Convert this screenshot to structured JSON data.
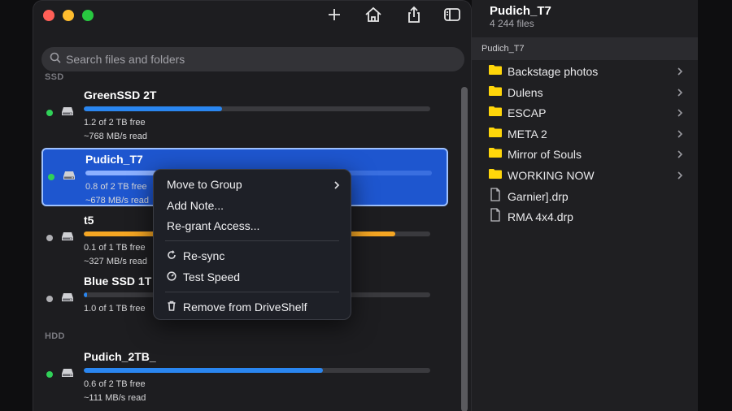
{
  "toolbar": {
    "add_icon": "plus-icon",
    "home_icon": "home-icon",
    "share_icon": "share-icon",
    "sidebar_icon": "sidebar-icon"
  },
  "search": {
    "placeholder": "Search files and folders"
  },
  "sections": {
    "ssd": "SSD",
    "hdd": "HDD"
  },
  "drives": [
    {
      "name": "GreenSSD 2T",
      "free": "1.2 of 2 TB free",
      "speed": "~768 MB/s read",
      "usage": 0.4,
      "bar_color": "#2a86f0",
      "status": "#30d158",
      "selected": false
    },
    {
      "name": "Pudich_T7",
      "free": "0.8 of 2 TB free",
      "speed": "~678 MB/s read",
      "usage": 0.6,
      "bar_color": "#8cb0ff",
      "status": "#30d158",
      "selected": true
    },
    {
      "name": "t5",
      "free": "0.1 of 1 TB free",
      "speed": "~327 MB/s read",
      "usage": 0.9,
      "bar_color": "#f5a623",
      "status": "#b0b0b4",
      "selected": false
    },
    {
      "name": "Blue SSD 1T",
      "free": "1.0 of 1 TB free",
      "speed": "",
      "usage": 0.01,
      "bar_color": "#2a86f0",
      "status": "#b0b0b4",
      "selected": false
    },
    {
      "name": "Pudich_2TB_",
      "free": "0.6 of 2 TB free",
      "speed": "~111 MB/s read",
      "usage": 0.69,
      "bar_color": "#2a86f0",
      "status": "#30d158",
      "selected": false
    }
  ],
  "context_menu": {
    "move_to_group": "Move to Group",
    "add_note": "Add Note...",
    "regrant": "Re-grant Access...",
    "resync": "Re-sync",
    "test_speed": "Test Speed",
    "remove": "Remove from DriveShelf"
  },
  "detail": {
    "title": "Pudich_T7",
    "subtitle": "4 244 files",
    "path": "Pudich_T7",
    "items": [
      {
        "name": "Backstage photos",
        "kind": "folder"
      },
      {
        "name": "Dulens",
        "kind": "folder"
      },
      {
        "name": "ESCAP",
        "kind": "folder"
      },
      {
        "name": "META 2",
        "kind": "folder"
      },
      {
        "name": "Mirror of Souls",
        "kind": "folder"
      },
      {
        "name": "WORKING NOW",
        "kind": "folder"
      },
      {
        "name": "Garnier].drp",
        "kind": "file"
      },
      {
        "name": "RMA 4x4.drp",
        "kind": "file"
      }
    ]
  }
}
